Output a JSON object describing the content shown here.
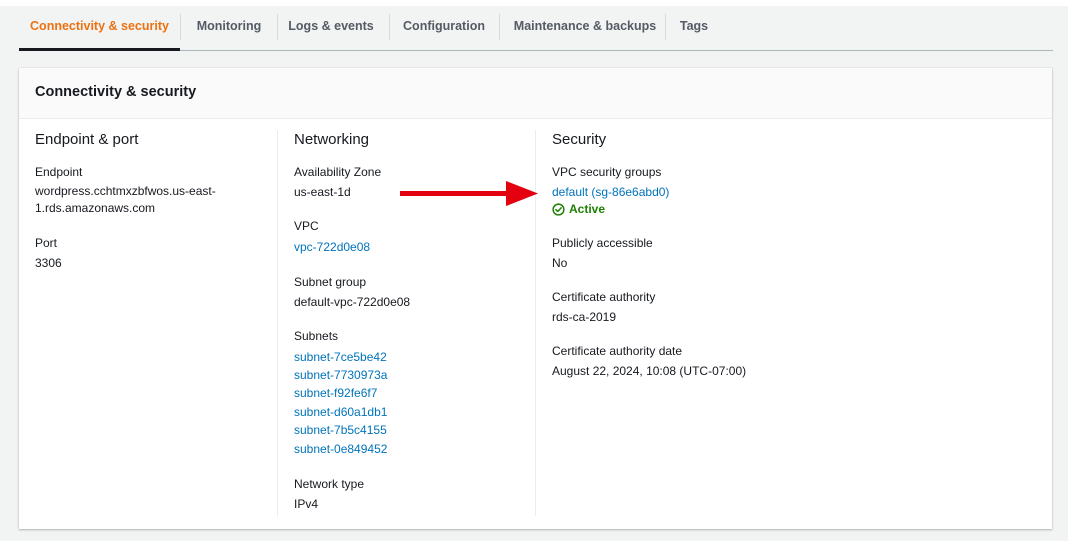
{
  "tabs": [
    {
      "label": "Connectivity & security",
      "active": true
    },
    {
      "label": "Monitoring"
    },
    {
      "label": "Logs & events"
    },
    {
      "label": "Configuration"
    },
    {
      "label": "Maintenance & backups"
    },
    {
      "label": "Tags"
    }
  ],
  "panel": {
    "title": "Connectivity & security"
  },
  "endpoint_port": {
    "title": "Endpoint & port",
    "endpoint_label": "Endpoint",
    "endpoint_value_line1": "wordpress.cchtmxzbfwos.us-east-",
    "endpoint_value_line2": "1.rds.amazonaws.com",
    "port_label": "Port",
    "port_value": "3306"
  },
  "networking": {
    "title": "Networking",
    "az_label": "Availability Zone",
    "az_value": "us-east-1d",
    "vpc_label": "VPC",
    "vpc_value": "vpc-722d0e08",
    "subnet_group_label": "Subnet group",
    "subnet_group_value": "default-vpc-722d0e08",
    "subnets_label": "Subnets",
    "subnets": [
      "subnet-7ce5be42",
      "subnet-7730973a",
      "subnet-f92fe6f7",
      "subnet-d60a1db1",
      "subnet-7b5c4155",
      "subnet-0e849452"
    ],
    "network_type_label": "Network type",
    "network_type_value": "IPv4"
  },
  "security": {
    "title": "Security",
    "vpc_sg_label": "VPC security groups",
    "vpc_sg_value": "default (sg-86e6abd0)",
    "vpc_sg_status": "Active",
    "public_label": "Publicly accessible",
    "public_value": "No",
    "ca_label": "Certificate authority",
    "ca_value": "rds-ca-2019",
    "ca_date_label": "Certificate authority date",
    "ca_date_value": "August 22, 2024, 10:08 (UTC-07:00)"
  },
  "colors": {
    "active_tab": "#ec7211",
    "link": "#0073bb",
    "status_ok": "#1d8102",
    "annotation_arrow": "#e3000f"
  },
  "icons": {
    "status": "check-circle-icon",
    "annotation": "red-arrow-icon"
  }
}
